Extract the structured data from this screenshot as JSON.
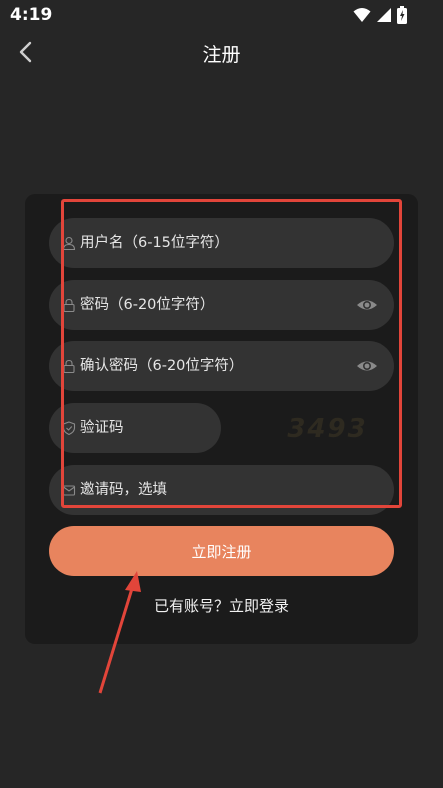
{
  "status_bar": {
    "time": "4:19"
  },
  "header": {
    "title": "注册"
  },
  "form": {
    "username_placeholder": "用户名（6-15位字符）",
    "password_placeholder": "密码（6-20位字符）",
    "confirm_placeholder": "确认密码（6-20位字符）",
    "captcha_placeholder": "验证码",
    "captcha_code": "3493",
    "invite_placeholder": "邀请码，选填"
  },
  "register_button": "立即注册",
  "login_link": "已有账号？立即登录",
  "colors": {
    "background": "#262626",
    "card": "#1b1b1b",
    "input": "#333333",
    "accent": "#e8845e",
    "annotation": "#e2453a"
  }
}
